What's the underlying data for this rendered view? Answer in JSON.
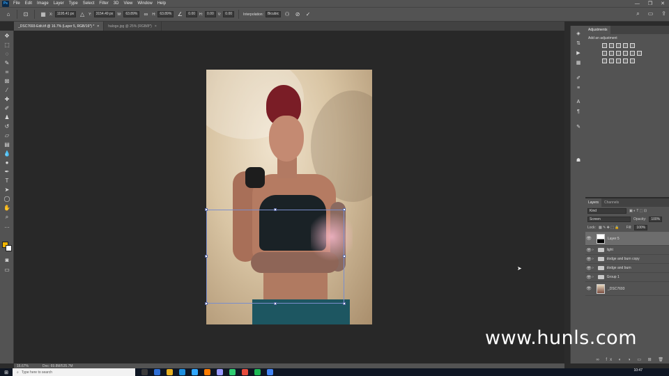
{
  "app": {
    "logo": "Ps"
  },
  "menu": [
    "File",
    "Edit",
    "Image",
    "Layer",
    "Type",
    "Select",
    "Filter",
    "3D",
    "View",
    "Window",
    "Help"
  ],
  "window_controls": [
    "—",
    "❐",
    "✕"
  ],
  "options_bar": {
    "x_label": "X:",
    "x_value": "1195.41 px",
    "y_label": "Y:",
    "y_value": "3154.49 px",
    "w_label": "W:",
    "w_value": "63.89%",
    "h_label": "H:",
    "h_value": "63.89%",
    "angle_value": "0.00",
    "hskew_label": "H:",
    "hskew_value": "0.00",
    "vskew_label": "V:",
    "vskew_value": "0.00",
    "interp_label": "Interpolation:",
    "interp_value": "Bicubic"
  },
  "tabs": [
    {
      "label": "_DSC7693-Edit.tif @ 16.7% (Layer 5, RGB/16*) *",
      "close": "×"
    },
    {
      "label": "haloge.jpg @ 25% (RGB/8*)",
      "close": "×"
    }
  ],
  "adjustments": {
    "tab": "Adjustments",
    "add_label": "Add an adjustment"
  },
  "layers_panel": {
    "tabs": [
      "Layers",
      "Channels"
    ],
    "filter_placeholder": "Kind",
    "blend_mode": "Screen",
    "opacity_label": "Opacity:",
    "opacity_value": "100%",
    "lock_label": "Lock:",
    "fill_label": "Fill:",
    "fill_value": "100%",
    "layers": [
      {
        "name": "Layer 5",
        "type": "layer",
        "selected": true
      },
      {
        "name": "light",
        "type": "group"
      },
      {
        "name": "dodge and burn copy",
        "type": "group"
      },
      {
        "name": "dodge and burn",
        "type": "group"
      },
      {
        "name": "Group 1",
        "type": "group"
      },
      {
        "name": "_DSC7693",
        "type": "photo"
      }
    ]
  },
  "status": {
    "zoom": "16.67%",
    "doc": "Doc: 69.8M/535.7M"
  },
  "taskbar": {
    "search_placeholder": "Type here to search",
    "time": "10:47"
  },
  "watermark": "www.hunls.com",
  "colors": {
    "foreground": "#f0b400",
    "background": "#ffffff",
    "accent": "#31a8ff"
  }
}
